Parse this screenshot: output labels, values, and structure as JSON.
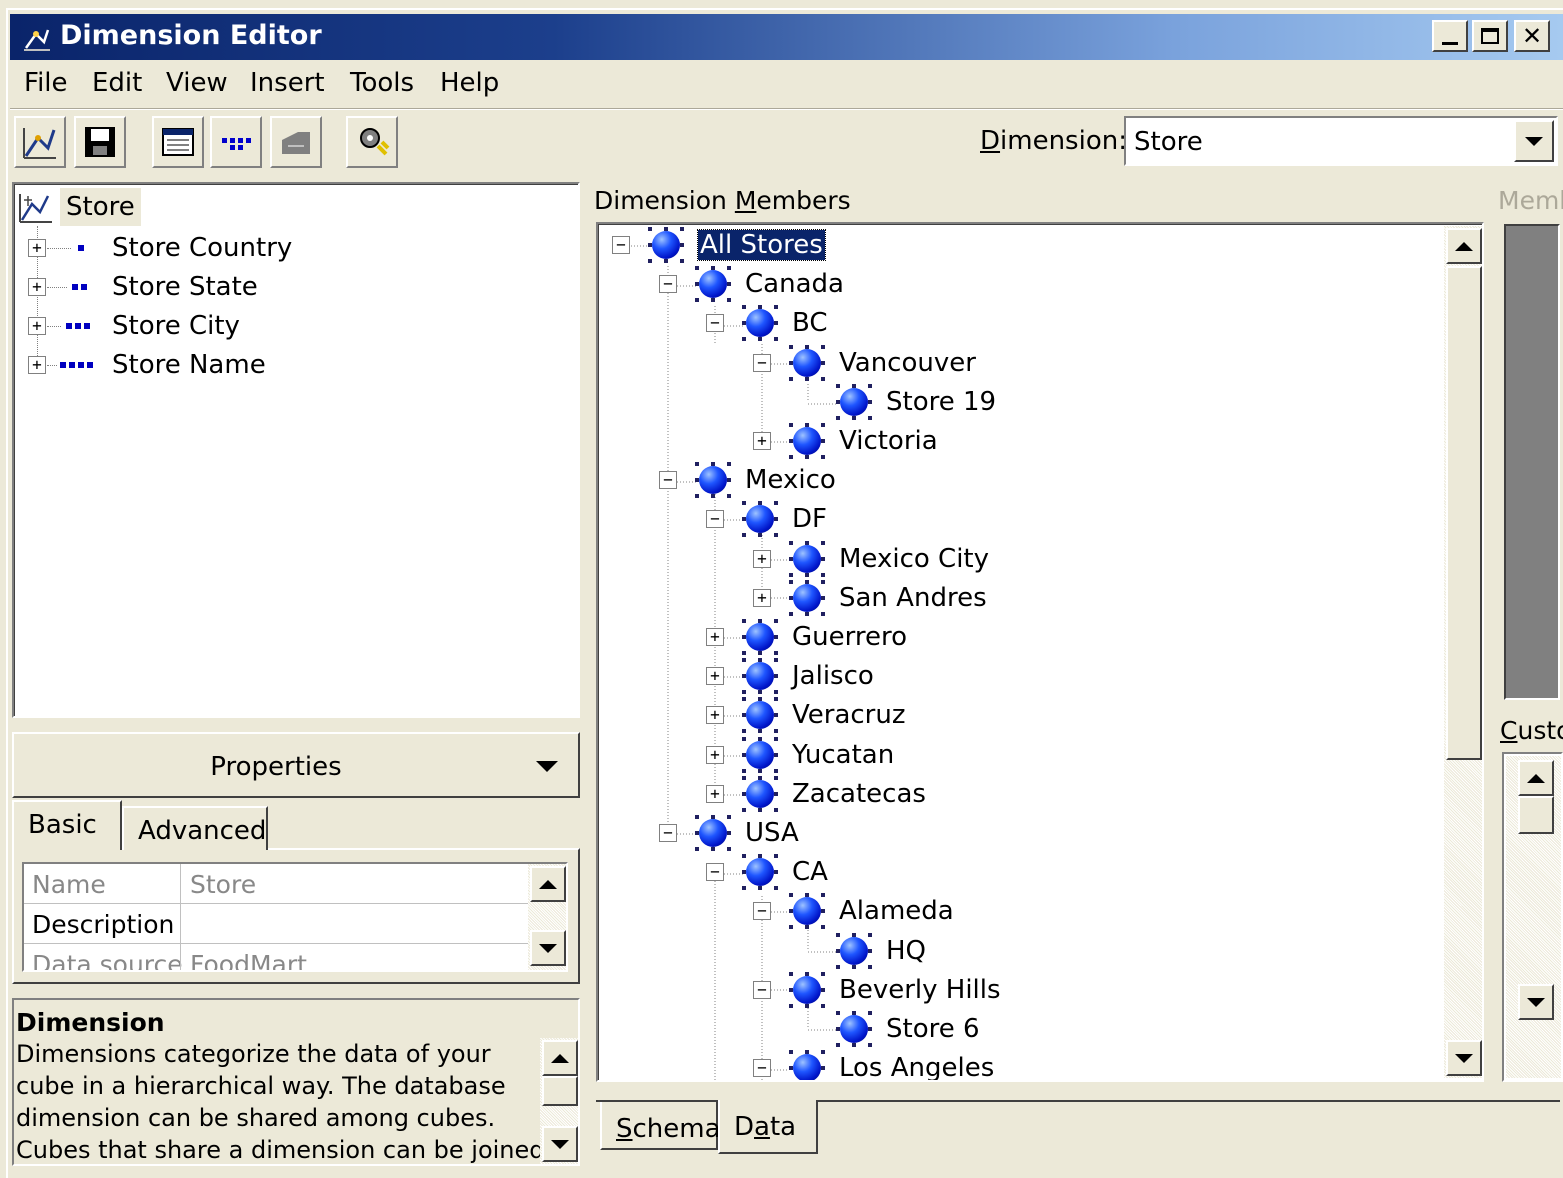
{
  "window": {
    "title": "Dimension Editor",
    "controls": [
      "minimize",
      "maximize",
      "close"
    ]
  },
  "menu": [
    "File",
    "Edit",
    "View",
    "Insert",
    "Tools",
    "Help"
  ],
  "toolbar": {
    "buttons": [
      "dimension-icon",
      "save-icon",
      "properties-icon",
      "levels-icon",
      "tool-icon",
      "process-icon"
    ],
    "dimension_label_pre": "D",
    "dimension_label_post": "imension:",
    "dimension_value": "Store"
  },
  "left_tree": {
    "root": "Store",
    "levels": [
      "Store Country",
      "Store State",
      "Store City",
      "Store Name"
    ]
  },
  "properties": {
    "button_label": "Properties",
    "tabs": [
      "Basic",
      "Advanced"
    ],
    "rows": [
      {
        "key": "Name",
        "value": "Store"
      },
      {
        "key": "Description",
        "value": ""
      },
      {
        "key": "Data source",
        "value": "FoodMart"
      }
    ]
  },
  "description": {
    "title": "Dimension",
    "text": "Dimensions categorize the data of your cube in a hierarchical way. The database dimension can be shared among cubes. Cubes that share a dimension can be joined"
  },
  "members": {
    "label_pre": "Dimension ",
    "label_u": "M",
    "label_post": "embers",
    "nodes": [
      {
        "label": "All Stores",
        "selected": true
      },
      {
        "label": "Canada"
      },
      {
        "label": "BC"
      },
      {
        "label": "Vancouver"
      },
      {
        "label": "Store 19"
      },
      {
        "label": "Victoria"
      },
      {
        "label": "Mexico"
      },
      {
        "label": "DF"
      },
      {
        "label": "Mexico City"
      },
      {
        "label": "San Andres"
      },
      {
        "label": "Guerrero"
      },
      {
        "label": "Jalisco"
      },
      {
        "label": "Veracruz"
      },
      {
        "label": "Yucatan"
      },
      {
        "label": "Zacatecas"
      },
      {
        "label": "USA"
      },
      {
        "label": "CA"
      },
      {
        "label": "Alameda"
      },
      {
        "label": "HQ"
      },
      {
        "label": "Beverly Hills"
      },
      {
        "label": "Store 6"
      },
      {
        "label": "Los Angeles"
      }
    ]
  },
  "right_panel": {
    "member_label": "Memb",
    "custom_label_u": "C",
    "custom_label_post": "usto"
  },
  "bottom_tabs": {
    "schema_u": "S",
    "schema_post": "chema",
    "data_pre": "D",
    "data_u": "a",
    "data_post": "ta"
  }
}
